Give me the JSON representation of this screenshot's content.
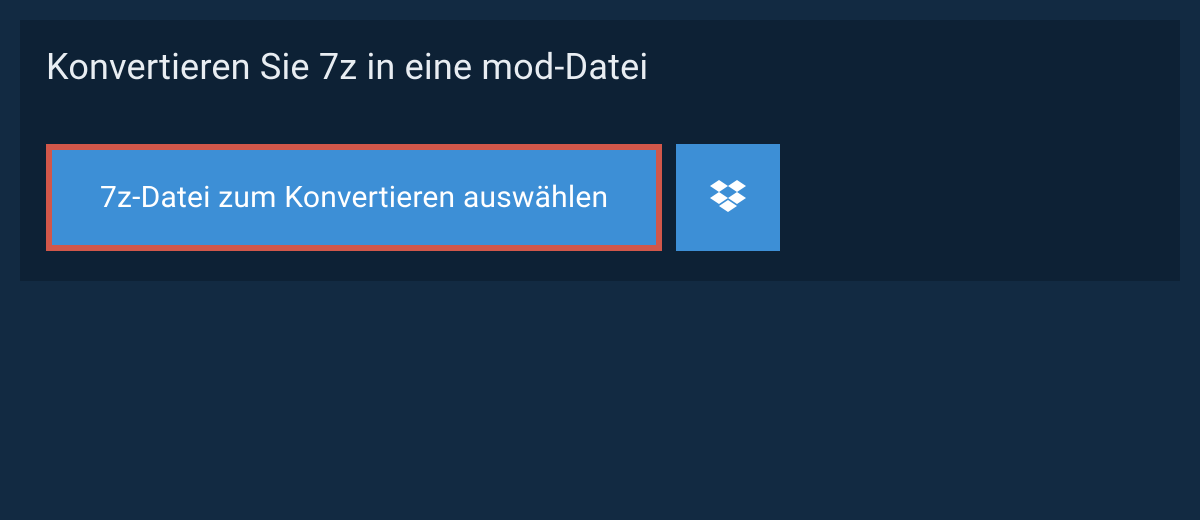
{
  "header": {
    "title": "Konvertieren Sie 7z in eine mod-Datei"
  },
  "actions": {
    "select_file_label": "7z-Datei zum Konvertieren auswählen",
    "dropbox_icon": "dropbox-icon"
  },
  "colors": {
    "background": "#122a42",
    "panel": "#0d2135",
    "button_primary": "#3d8fd6",
    "highlight_border": "#d1574a"
  }
}
